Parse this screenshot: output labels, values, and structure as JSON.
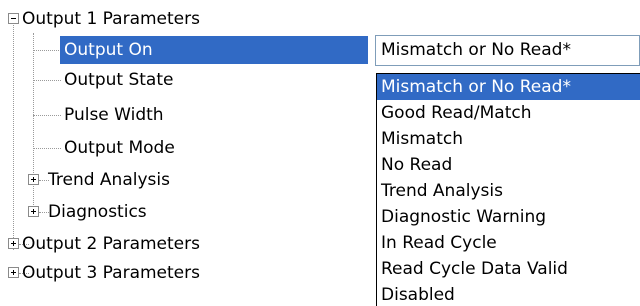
{
  "tree": {
    "output1": {
      "label": "Output 1 Parameters",
      "expanded": true
    },
    "output1_children": [
      {
        "label": "Output On",
        "selected": true
      },
      {
        "label": "Output State"
      },
      {
        "label": "Pulse Width"
      },
      {
        "label": "Output Mode"
      },
      {
        "label": "Trend Analysis",
        "expandable": true
      },
      {
        "label": "Diagnostics",
        "expandable": true
      }
    ],
    "output2": {
      "label": "Output 2 Parameters",
      "expanded": false
    },
    "output3": {
      "label": "Output 3 Parameters",
      "expanded": false
    }
  },
  "combo": {
    "value": "Mismatch or No Read*",
    "options": [
      "Mismatch or No Read*",
      "Good Read/Match",
      "Mismatch",
      "No Read",
      "Trend Analysis",
      "Diagnostic Warning",
      "In Read Cycle",
      "Read Cycle Data Valid",
      "Disabled"
    ],
    "selected_index": 0
  },
  "colors": {
    "selection": "#316ac5",
    "border": "#7f9db9"
  }
}
